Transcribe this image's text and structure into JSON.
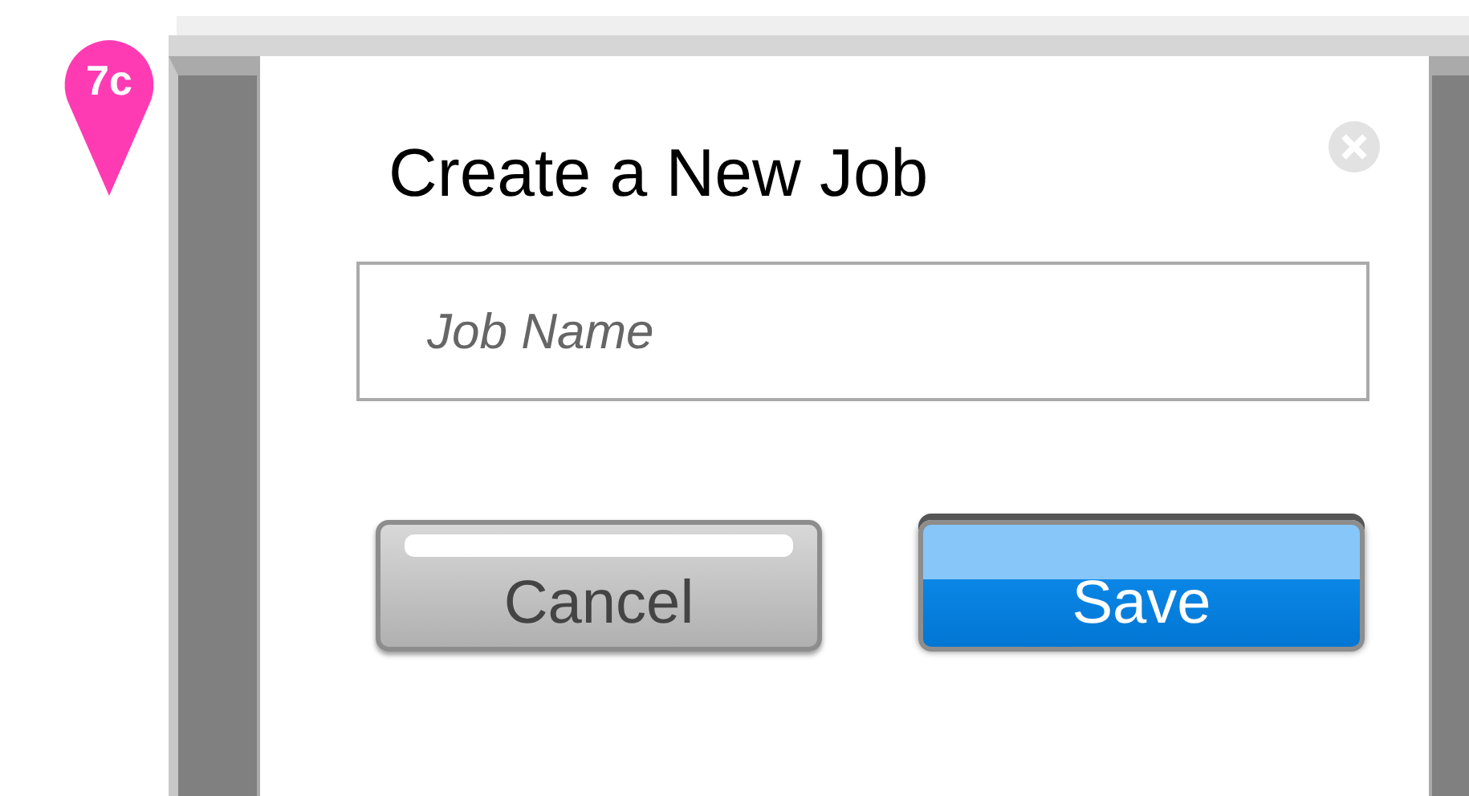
{
  "step_badge": "7c",
  "dialog": {
    "title": "Create a New Job",
    "job_name": {
      "placeholder": "Job Name"
    },
    "buttons": [
      {
        "label": "Cancel",
        "kind": "secondary"
      },
      {
        "label": "Save",
        "kind": "primary"
      }
    ]
  }
}
